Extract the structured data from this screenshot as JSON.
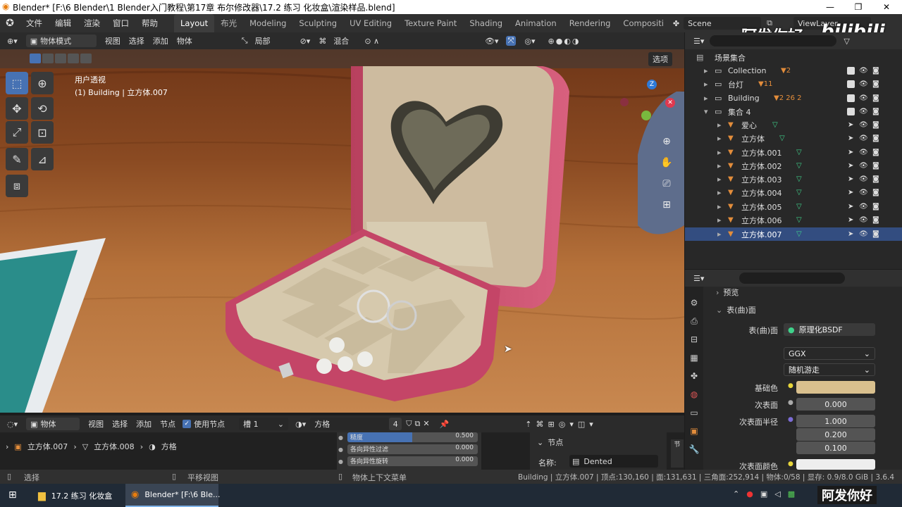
{
  "window": {
    "title": "Blender* [F:\\6 Blender\\1 Blender入门教程\\第17章 布尔修改器\\17.2 练习 化妆盒\\渲染样品.blend]",
    "minimize": "—",
    "maximize": "❐",
    "close": "✕"
  },
  "menu": [
    "文件",
    "编辑",
    "渲染",
    "窗口",
    "帮助"
  ],
  "workspaces": [
    "Layout",
    "布光",
    "Modeling",
    "Sculpting",
    "UV Editing",
    "Texture Paint",
    "Shading",
    "Animation",
    "Rendering",
    "Compositi"
  ],
  "scene": {
    "name": "Scene",
    "view_layer": "ViewLayer"
  },
  "viewport_header": {
    "mode": "物体模式",
    "menus": [
      "视图",
      "选择",
      "添加",
      "物体"
    ],
    "transform": "局部",
    "snap": "混合"
  },
  "viewport": {
    "view_name": "用户透视",
    "object_info": "(1) Building | 立方体.007",
    "options": "选项",
    "gizmo": {
      "z": "Z"
    }
  },
  "watermark": {
    "text": "阿发你好",
    "logo": "bilibili",
    "bottom": "阿发你好"
  },
  "outliner": {
    "root": "场景集合",
    "rows": [
      {
        "name": "Collection",
        "badge": "2"
      },
      {
        "name": "台灯",
        "badge": "11"
      },
      {
        "name": "Building",
        "badge": "2  26  2"
      },
      {
        "name": "集合 4",
        "badge": ""
      },
      {
        "name": "爱心"
      },
      {
        "name": "立方体"
      },
      {
        "name": "立方体.001"
      },
      {
        "name": "立方体.002"
      },
      {
        "name": "立方体.003"
      },
      {
        "name": "立方体.004"
      },
      {
        "name": "立方体.005"
      },
      {
        "name": "立方体.006"
      },
      {
        "name": "立方体.007"
      }
    ]
  },
  "properties": {
    "preview": "预览",
    "surface_section": "表(曲)面",
    "surface_label": "表(曲)面",
    "surface_value": "原理化BSDF",
    "distribution": "GGX",
    "subsurface_method": "随机游走",
    "base_color_label": "基础色",
    "base_color": "#d9c08e",
    "subsurface_label": "次表面",
    "subsurface_value": "0.000",
    "subsurface_radius_label": "次表面半径",
    "radius": [
      "1.000",
      "0.200",
      "0.100"
    ],
    "subsurface_color_label": "次表面颜色"
  },
  "node_header": {
    "type": "物体",
    "menus": [
      "视图",
      "选择",
      "添加",
      "节点"
    ],
    "use_nodes": "使用节点",
    "slot": "槽 1",
    "material": "方格",
    "users": "4"
  },
  "node_area": {
    "breadcrumb": [
      "立方体.007",
      "立方体.008",
      "方格"
    ],
    "fields": [
      {
        "label": "糙度",
        "value": "0.500"
      },
      {
        "label": "各向异性过滤",
        "value": "0.000"
      },
      {
        "label": "各向异性旋转",
        "value": "0.000"
      }
    ],
    "panel_title": "节点",
    "name_label": "名称:",
    "name_value": "Dented"
  },
  "status": {
    "left": "选择",
    "middle1": "平移视图",
    "middle2": "物体上下文菜单",
    "right": "Building | 立方体.007 | 顶点:130,160 | 面:131,631 | 三角面:252,914 | 物体:0/58 | 显存: 0.9/8.0 GiB | 3.6.4"
  },
  "taskbar": {
    "items": [
      "17.2 练习 化妆盒",
      "Blender* [F:\\6 Ble..."
    ]
  }
}
